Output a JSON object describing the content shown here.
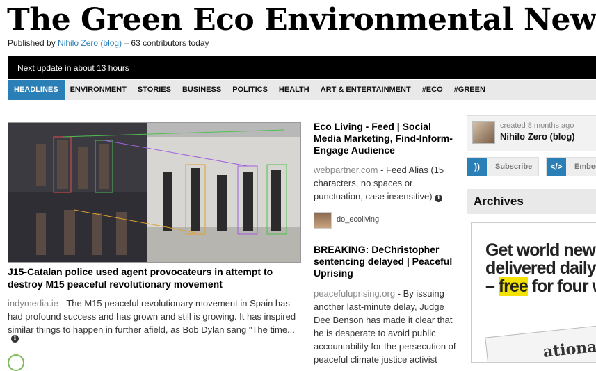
{
  "site": {
    "title": "The Green Eco Environmental News",
    "byline_prefix": "Published by ",
    "byline_author": "Nihilo Zero (blog)",
    "byline_suffix": " – 63 contributors today"
  },
  "topbar": {
    "text": "Next update in about 13 hours"
  },
  "nav": {
    "items": [
      "HEADLINES",
      "ENVIRONMENT",
      "STORIES",
      "BUSINESS",
      "POLITICS",
      "HEALTH",
      "ART & ENTERTAINMENT",
      "#ECO",
      "#GREEN"
    ],
    "active_index": 0
  },
  "main_story": {
    "headline": "J15-Catalan police used agent provocateurs in attempt to destroy M15 peaceful revolutionary movement",
    "source": "indymedia.ie",
    "excerpt": " - The M15 peaceful revolutionary movement in Spain has had profound success and has grown and still is growing. It has inspired similar things to happen in further afield, as Bob Dylan sang \"The time..."
  },
  "story2": {
    "headline": "Eco Living - Feed | Social Media Marketing, Find-Inform-Engage Audience",
    "source": "webpartner.com",
    "excerpt": " - Feed Alias (15 characters, no spaces or punctuation, case insensitive)",
    "author": "do_ecoliving"
  },
  "story3": {
    "headline": "BREAKING: DeChristopher sentencing delayed | Peaceful Uprising",
    "source": "peacefuluprising.org",
    "excerpt": " - By issuing another last-minute delay, Judge Dee Benson has made it clear that he is desperate to avoid public accountability for the persecution of peaceful climate justice activist"
  },
  "sidebar": {
    "created": "created 8 months ago",
    "name": "Nihilo Zero (blog)",
    "subscribe": "Subscribe",
    "embed": "Embed",
    "archives": "Archives"
  },
  "ad": {
    "line1": "Get world new",
    "line2": "delivered daily",
    "line3_a": "– ",
    "line3_b": "free",
    "line3_c": " for four w",
    "paper": "ational"
  },
  "colors": {
    "accent": "#2a7fb6",
    "bar": "#000000",
    "nav_bg": "#e9e9e9",
    "ad_highlight": "#f4e300"
  }
}
